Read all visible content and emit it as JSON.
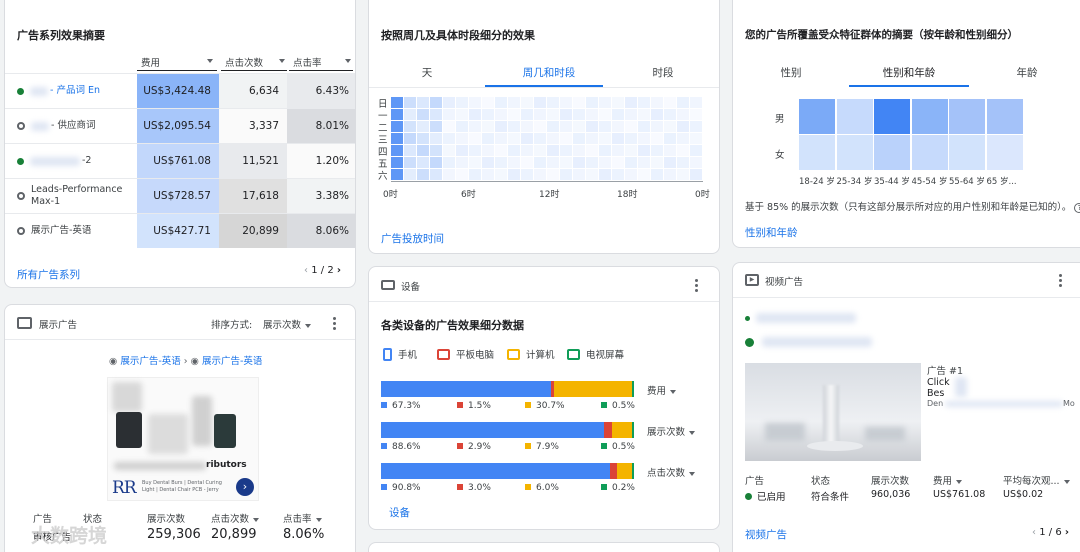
{
  "campaign_summary": {
    "title": "广告系列效果摘要",
    "columns": [
      "费用",
      "点击次数",
      "点击率"
    ],
    "rows": [
      {
        "name": "- 产品词 En",
        "cost": "US$3,424.48",
        "clicks": "6,634",
        "ctr": "6.43%",
        "status": "active"
      },
      {
        "name": "- 供应商词",
        "cost": "US$2,095.54",
        "clicks": "3,337",
        "ctr": "8.01%",
        "status": "paused"
      },
      {
        "name": "-2",
        "cost": "US$761.08",
        "clicks": "11,521",
        "ctr": "1.20%",
        "status": "active"
      },
      {
        "name": "Leads-Performance Max-1",
        "cost": "US$728.57",
        "clicks": "17,618",
        "ctr": "3.38%",
        "status": "paused"
      },
      {
        "name": "展示广告-英语",
        "cost": "US$427.71",
        "clicks": "20,899",
        "ctr": "8.06%",
        "status": "paused"
      }
    ],
    "link": "所有广告系列",
    "pager": "1 / 2"
  },
  "display_ads": {
    "title": "展示广告",
    "sort_label": "排序方式:",
    "sort_value": "展示次数",
    "breadcrumb_a": "展示广告-英语",
    "breadcrumb_b": "展示广告-英语",
    "ad_text_1": "ributors",
    "ad_text_2": "Buy Dental Burs | Dental Curing Light | Dental Chair PCB - Jerry",
    "ad_logo": "RR",
    "stat_headers": [
      "广告",
      "状态",
      "展示次数",
      "点击次数",
      "点击率"
    ],
    "stat_values": [
      "审核广告",
      "",
      "259,306",
      "20,899",
      "8.06%"
    ],
    "watermark": "大数跨境"
  },
  "time_breakdown": {
    "title": "按照周几及具体时段细分的效果",
    "tabs": [
      "天",
      "周几和时段",
      "时段"
    ],
    "active_tab": 1,
    "days": [
      "日",
      "一",
      "二",
      "三",
      "四",
      "五",
      "六"
    ],
    "hour_ticks": [
      "0时",
      "6时",
      "12时",
      "18时",
      "0时"
    ],
    "link": "广告投放时间"
  },
  "audience": {
    "title": "您的广告所覆盖受众特征群体的摘要（按年龄和性别细分）",
    "tabs": [
      "性别",
      "性别和年龄",
      "年龄"
    ],
    "active_tab": 1,
    "genders": [
      "男",
      "女"
    ],
    "ages": [
      "18-24 岁",
      "25-34 岁",
      "35-44 岁",
      "45-54 岁",
      "55-64 岁",
      "65 岁..."
    ],
    "note": "基于 85% 的展示次数（只有这部分展示所对应的用户性别和年龄是已知的）。",
    "link": "性别和年龄"
  },
  "devices": {
    "header": "设备",
    "title": "各类设备的广告效果细分数据",
    "legend": [
      "手机",
      "平板电脑",
      "计算机",
      "电视屏幕"
    ],
    "colors": [
      "#4285f4",
      "#db4437",
      "#f4b400",
      "#0f9d58"
    ],
    "bars": [
      {
        "metric": "费用",
        "values": [
          67.3,
          1.5,
          30.7,
          0.5
        ],
        "labels": [
          "67.3%",
          "1.5%",
          "30.7%",
          "0.5%"
        ]
      },
      {
        "metric": "展示次数",
        "values": [
          88.6,
          2.9,
          7.9,
          0.5
        ],
        "labels": [
          "88.6%",
          "2.9%",
          "7.9%",
          "0.5%"
        ]
      },
      {
        "metric": "点击次数",
        "values": [
          90.8,
          3.0,
          6.0,
          0.2
        ],
        "labels": [
          "90.8%",
          "3.0%",
          "6.0%",
          "0.2%"
        ]
      }
    ],
    "link": "设备"
  },
  "video_ads": {
    "title": "视频广告",
    "ad_label": "广告 #1",
    "ad_line_1": "Click",
    "ad_line_2": "Bes",
    "ad_line_3": "Den",
    "ad_line_tail": "Mo",
    "stat_headers": [
      "广告",
      "状态",
      "展示次数",
      "费用",
      "平均每次观..."
    ],
    "stat_values": [
      "已启用",
      "符合条件",
      "960,036",
      "US$761.08",
      "US$0.02"
    ],
    "link": "视频广告",
    "pager": "1 / 6"
  }
}
